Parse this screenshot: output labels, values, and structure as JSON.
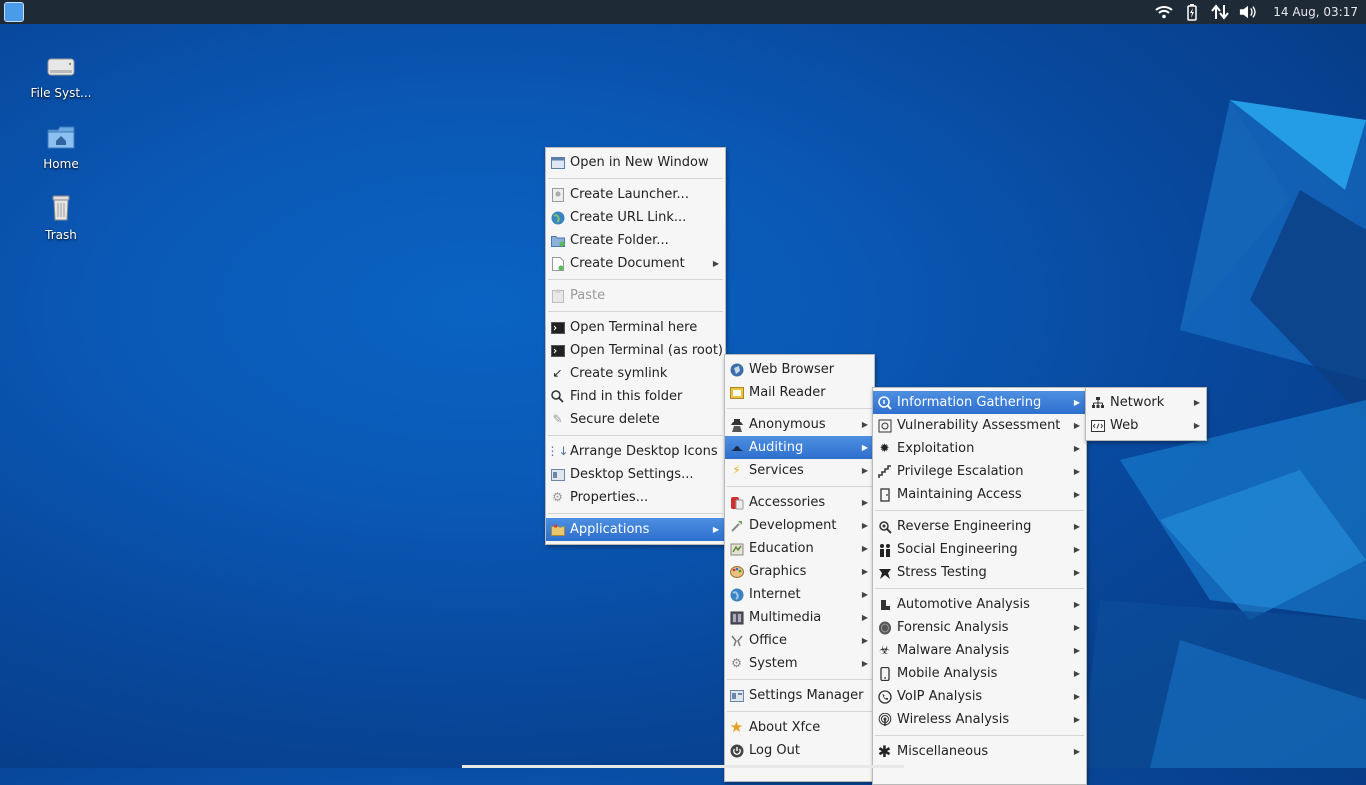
{
  "panel": {
    "clock": "14 Aug, 03:17",
    "tray_icons": [
      "wifi-icon",
      "battery-icon",
      "network-arrows-icon",
      "volume-icon"
    ]
  },
  "desktop": {
    "icons": [
      {
        "label": "File Syst...",
        "icon": "drive-icon"
      },
      {
        "label": "Home",
        "icon": "home-folder-icon"
      },
      {
        "label": "Trash",
        "icon": "trash-icon"
      }
    ]
  },
  "context_menu": {
    "open_new_window": "Open in New Window",
    "create_launcher": "Create Launcher...",
    "create_url_link": "Create URL Link...",
    "create_folder": "Create Folder...",
    "create_document": "Create Document",
    "paste": "Paste",
    "open_terminal": "Open Terminal here",
    "open_terminal_root": "Open Terminal (as root)",
    "create_symlink": "Create symlink",
    "find_in_folder": "Find in this folder",
    "secure_delete": "Secure delete",
    "arrange_icons": "Arrange Desktop Icons",
    "desktop_settings": "Desktop Settings...",
    "properties": "Properties...",
    "applications": "Applications"
  },
  "apps_menu": {
    "web_browser": "Web Browser",
    "mail_reader": "Mail Reader",
    "anonymous": "Anonymous",
    "auditing": "Auditing",
    "services": "Services",
    "accessories": "Accessories",
    "development": "Development",
    "education": "Education",
    "graphics": "Graphics",
    "internet": "Internet",
    "multimedia": "Multimedia",
    "office": "Office",
    "system": "System",
    "settings_manager": "Settings Manager",
    "about_xfce": "About Xfce",
    "log_out": "Log Out"
  },
  "auditing_menu": {
    "information_gathering": "Information Gathering",
    "vulnerability_assessment": "Vulnerability Assessment",
    "exploitation": "Exploitation",
    "privilege_escalation": "Privilege Escalation",
    "maintaining_access": "Maintaining Access",
    "reverse_engineering": "Reverse Engineering",
    "social_engineering": "Social Engineering",
    "stress_testing": "Stress Testing",
    "automotive_analysis": "Automotive Analysis",
    "forensic_analysis": "Forensic Analysis",
    "malware_analysis": "Malware Analysis",
    "mobile_analysis": "Mobile Analysis",
    "voip_analysis": "VoIP Analysis",
    "wireless_analysis": "Wireless Analysis",
    "miscellaneous": "Miscellaneous"
  },
  "info_gathering_menu": {
    "network": "Network",
    "web": "Web"
  },
  "colors": {
    "panel": "#1f2a37",
    "desktop": "#0a58b5",
    "menu_bg": "#f6f6f6",
    "selection": "#3b7dd8"
  }
}
